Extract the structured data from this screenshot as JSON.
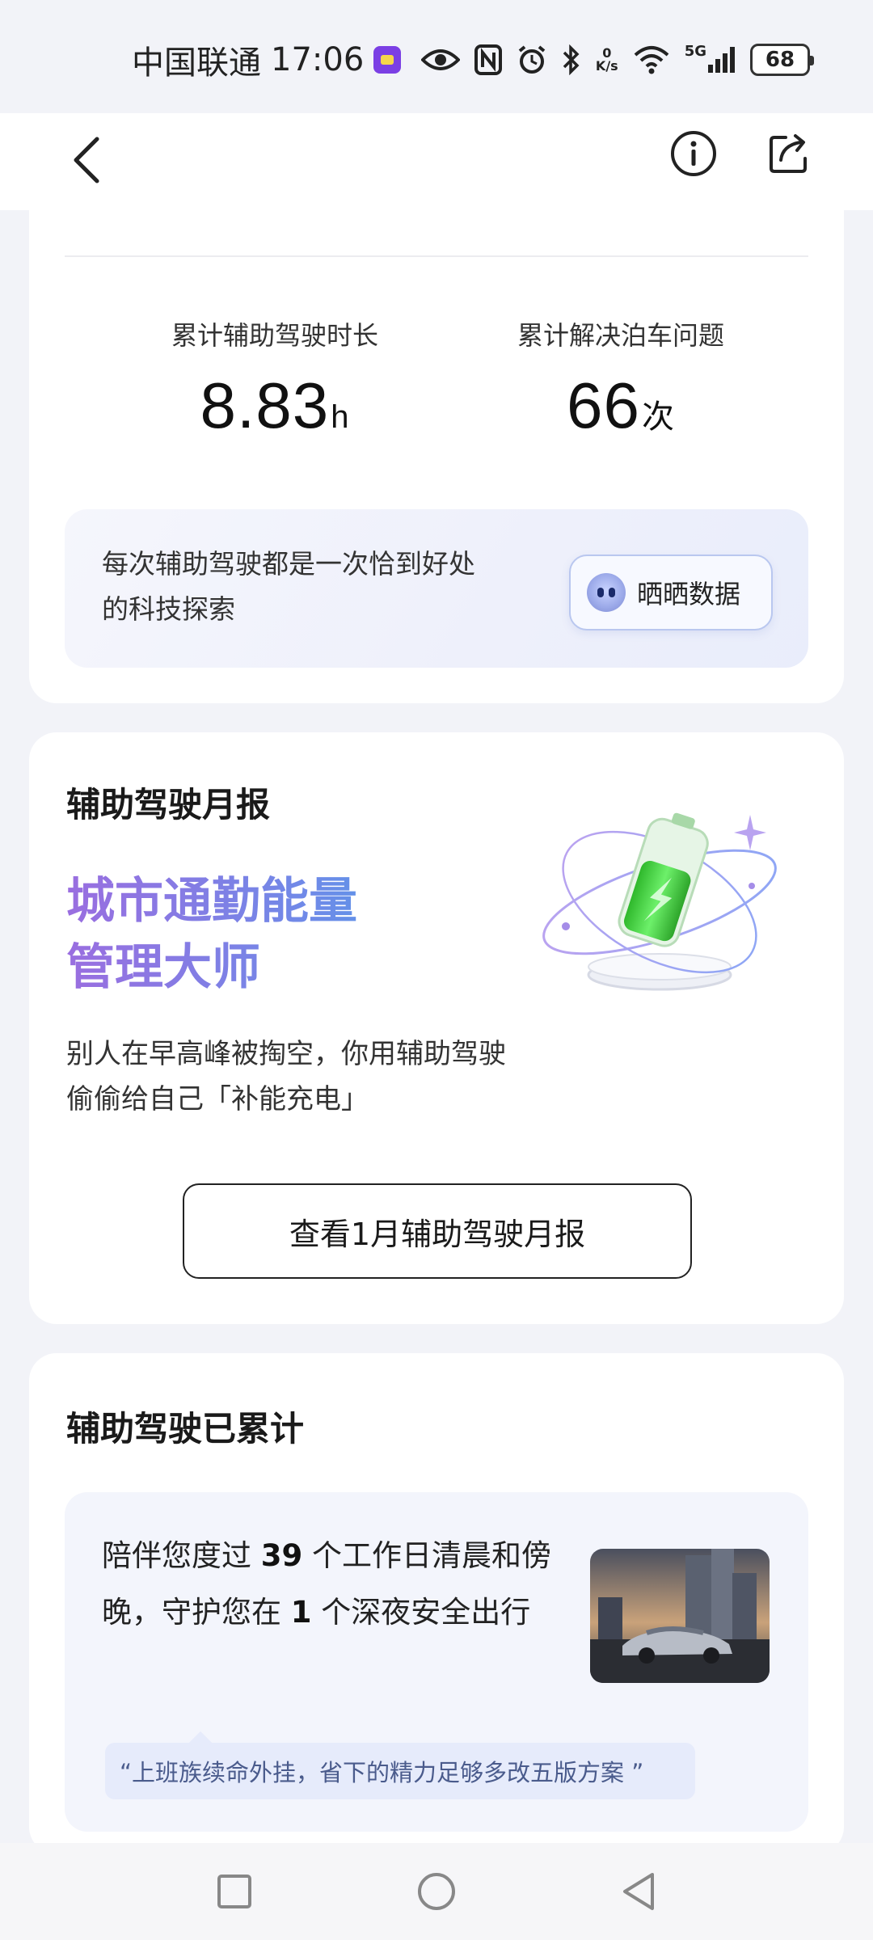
{
  "status_bar": {
    "carrier": "中国联通",
    "time": "17:06",
    "speed_value": "0",
    "speed_unit": "K/s",
    "network": "5G",
    "battery": "68"
  },
  "stats": {
    "duration_label": "累计辅助驾驶时长",
    "duration_value": "8.83",
    "duration_unit": "h",
    "parking_label": "累计解决泊车问题",
    "parking_value": "66",
    "parking_unit": "次"
  },
  "promo": {
    "text": "每次辅助驾驶都是一次恰到好处的科技探索",
    "share_label": "晒晒数据"
  },
  "monthly": {
    "title": "辅助驾驶月报",
    "hero_line1": "城市通勤能量",
    "hero_line2": "管理大师",
    "subtitle": "别人在早高峰被掏空，你用辅助驾驶偷偷给自己「补能充电」",
    "button": "查看1月辅助驾驶月报"
  },
  "accumulated": {
    "title": "辅助驾驶已累计",
    "text_a": "陪伴您度过 ",
    "workdays": "39",
    "text_b": " 个工作日清晨和傍晚，守护您在 ",
    "nights": "1",
    "text_c": " 个深夜安全出行",
    "quote": "“上班族续命外挂，省下的精力足够多改五版方案 ”"
  },
  "colors": {
    "gradient_start": "#9a6ee0",
    "gradient_end": "#3ba6ea",
    "battery_green": "#3dcf3a"
  }
}
